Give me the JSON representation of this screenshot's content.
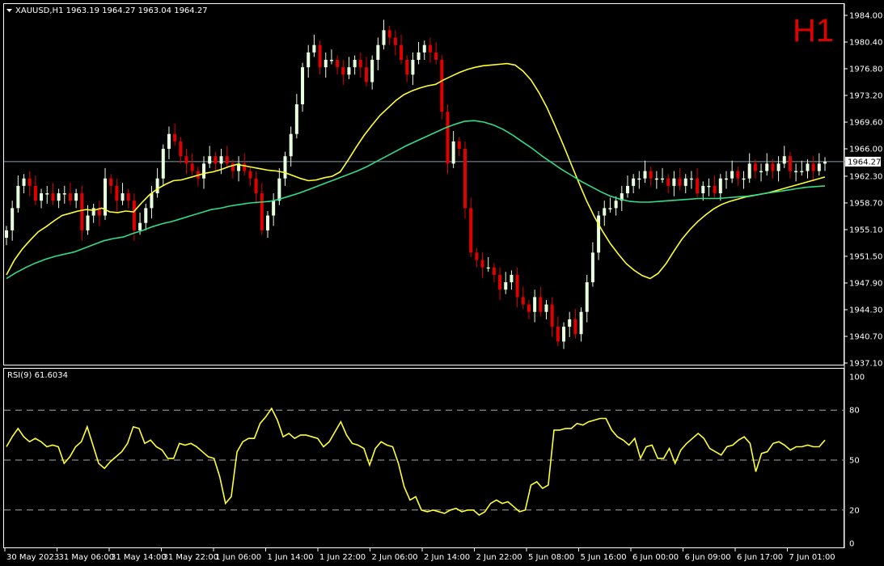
{
  "header": {
    "symbol_line": "XAUUSD,H1  1963.19 1964.27 1963.04 1964.27",
    "timeframe": "H1"
  },
  "indicator": {
    "label": "RSI(9) 61.6034",
    "scale": [
      "100",
      "80",
      "50",
      "20",
      "0"
    ]
  },
  "colors": {
    "background": "#000000",
    "bull_candle": "#e8ffe0",
    "bear_candle": "#e00000",
    "ma_fast": "#ffff33",
    "ma_slow": "#33dd88",
    "rsi_line": "#ffff33",
    "frame": "#ffffff",
    "price_line": "#8899aa"
  },
  "chart_data": [
    {
      "type": "candlestick",
      "symbol": "XAUUSD",
      "timeframe": "H1",
      "current_price": 1964.27,
      "price_label": "1964.27",
      "ylim": [
        1937.1,
        1984.0
      ],
      "y_ticks": [
        "1984.00",
        "1980.40",
        "1976.80",
        "1973.20",
        "1969.60",
        "1966.00",
        "1962.30",
        "1958.70",
        "1955.10",
        "1951.50",
        "1947.90",
        "1944.30",
        "1940.70",
        "1937.10"
      ],
      "x_ticks": [
        "30 May 2023",
        "31 May 06:00",
        "31 May 14:00",
        "31 May 22:00",
        "1 Jun 06:00",
        "1 Jun 14:00",
        "1 Jun 22:00",
        "2 Jun 06:00",
        "2 Jun 14:00",
        "2 Jun 22:00",
        "5 Jun 08:00",
        "5 Jun 16:00",
        "6 Jun 00:00",
        "6 Jun 09:00",
        "6 Jun 17:00",
        "7 Jun 01:00"
      ],
      "close": [
        1955,
        1958,
        1961,
        1962,
        1961,
        1959,
        1960,
        1960,
        1959,
        1960,
        1960,
        1959,
        1960,
        1955,
        1957,
        1958,
        1957,
        1962,
        1961,
        1959,
        1960,
        1959,
        1955,
        1956,
        1958,
        1960,
        1962,
        1966,
        1968,
        1967,
        1965,
        1964,
        1963,
        1962,
        1964,
        1965,
        1964,
        1965,
        1964,
        1963,
        1964,
        1963,
        1962,
        1960,
        1955,
        1957,
        1959,
        1962,
        1965,
        1968,
        1972,
        1977,
        1979,
        1980,
        1977,
        1978,
        1978,
        1977,
        1976,
        1977,
        1978,
        1977,
        1975,
        1978,
        1980,
        1982,
        1981,
        1980,
        1978,
        1976,
        1978,
        1979,
        1980,
        1979,
        1978,
        1971,
        1964,
        1967,
        1966,
        1958,
        1952,
        1951,
        1950,
        1950,
        1949,
        1947,
        1948,
        1949,
        1946,
        1945,
        1944,
        1946,
        1944,
        1945,
        1942,
        1940,
        1942,
        1943,
        1941,
        1944,
        1948,
        1952,
        1957,
        1958,
        1958,
        1959,
        1960,
        1961,
        1962,
        1962,
        1963,
        1962,
        1962,
        1962,
        1961,
        1962,
        1961,
        1962,
        1962,
        1960,
        1961,
        1961,
        1960,
        1962,
        1962,
        1963,
        1962,
        1962,
        1964,
        1963,
        1963,
        1964,
        1963,
        1964,
        1965,
        1963,
        1963,
        1963,
        1964,
        1963,
        1964,
        1964.27
      ],
      "series": [
        {
          "name": "",
          "description_color": "ma_fast",
          "values": [
            1949,
            1951,
            1952.5,
            1953.7,
            1954.8,
            1955.5,
            1956.3,
            1957,
            1957.3,
            1957.6,
            1957.8,
            1957.7,
            1958,
            1957.5,
            1957.4,
            1957.6,
            1957.5,
            1958.7,
            1959.8,
            1960.6,
            1961.2,
            1961.7,
            1961.8,
            1962.1,
            1962.4,
            1962.7,
            1962.9,
            1963.2,
            1963.6,
            1963.9,
            1963.7,
            1963.5,
            1963.3,
            1963.1,
            1963.0,
            1962.8,
            1962.4,
            1962.0,
            1961.7,
            1961.8,
            1962.1,
            1962.3,
            1962.9,
            1964.5,
            1966.2,
            1967.8,
            1969.2,
            1970.5,
            1971.5,
            1972.5,
            1973.3,
            1973.8,
            1974.2,
            1974.5,
            1974.7,
            1975.3,
            1975.8,
            1976.3,
            1976.7,
            1977.0,
            1977.2,
            1977.3,
            1977.4,
            1977.5,
            1977.3,
            1976.5,
            1975.3,
            1973.6,
            1971.6,
            1969.2,
            1966.7,
            1964.1,
            1961.5,
            1959.0,
            1956.8,
            1954.9,
            1953.2,
            1951.8,
            1950.5,
            1949.6,
            1948.9,
            1948.5,
            1949.2,
            1950.5,
            1952.2,
            1953.8,
            1955.1,
            1956.2,
            1957.1,
            1957.9,
            1958.5,
            1958.9,
            1959.2,
            1959.5,
            1959.7,
            1959.9,
            1960.1,
            1960.4,
            1960.7,
            1961.0,
            1961.3,
            1961.6,
            1961.9,
            1962.2
          ]
        },
        {
          "name": "",
          "description_color": "ma_slow",
          "values": [
            1948.5,
            1949.3,
            1950.0,
            1950.6,
            1951.1,
            1951.5,
            1951.8,
            1952.1,
            1952.6,
            1953.1,
            1953.6,
            1953.9,
            1954.1,
            1954.6,
            1955.0,
            1955.5,
            1955.9,
            1956.2,
            1956.6,
            1957.0,
            1957.4,
            1957.8,
            1958.0,
            1958.3,
            1958.5,
            1958.7,
            1958.8,
            1958.9,
            1959.2,
            1959.6,
            1960.0,
            1960.5,
            1961.0,
            1961.5,
            1962.0,
            1962.5,
            1963.0,
            1963.6,
            1964.3,
            1965.0,
            1965.7,
            1966.4,
            1967.0,
            1967.6,
            1968.2,
            1968.8,
            1969.3,
            1969.7,
            1969.8,
            1969.6,
            1969.2,
            1968.6,
            1967.8,
            1966.9,
            1966.0,
            1965.0,
            1964.1,
            1963.2,
            1962.4,
            1961.6,
            1960.9,
            1960.2,
            1959.6,
            1959.2,
            1958.9,
            1958.8,
            1958.8,
            1958.9,
            1959.0,
            1959.1,
            1959.2,
            1959.3,
            1959.3,
            1959.3,
            1959.4,
            1959.5,
            1959.6,
            1959.8,
            1960.0,
            1960.2,
            1960.4,
            1960.6,
            1960.8,
            1960.9,
            1961.0
          ]
        }
      ]
    },
    {
      "type": "line",
      "title": "RSI(9) 61.6034",
      "ylim": [
        0,
        100
      ],
      "levels": [
        80,
        50,
        20
      ],
      "x_ticks": [
        "30 May 2023",
        "31 May 06:00",
        "31 May 14:00",
        "31 May 22:00",
        "1 Jun 06:00",
        "1 Jun 14:00",
        "1 Jun 22:00",
        "2 Jun 06:00",
        "2 Jun 14:00",
        "2 Jun 22:00",
        "5 Jun 08:00",
        "5 Jun 16:00",
        "6 Jun 00:00",
        "6 Jun 09:00",
        "6 Jun 17:00",
        "7 Jun 01:00"
      ],
      "series": [
        {
          "name": "",
          "values": [
            58,
            64,
            69,
            64,
            61,
            63,
            61,
            58,
            59,
            58,
            48,
            52,
            58,
            61,
            70,
            59,
            48,
            45,
            49,
            52,
            55,
            60,
            70,
            69,
            60,
            62,
            58,
            56,
            51,
            51,
            60,
            59,
            60,
            58,
            55,
            52,
            51,
            40,
            24,
            28,
            55,
            61,
            63,
            63,
            72,
            76,
            81,
            74,
            64,
            66,
            63,
            65,
            65,
            64,
            63,
            58,
            61,
            67,
            73,
            65,
            60,
            59,
            57,
            47,
            57,
            61,
            59,
            58,
            48,
            34,
            26,
            28,
            20,
            19,
            20,
            19,
            18,
            20,
            21,
            19,
            20,
            20,
            17,
            19,
            24,
            26,
            24,
            25,
            22,
            19,
            20,
            35,
            37,
            33,
            35,
            68,
            68,
            69,
            69,
            72,
            71,
            73,
            74,
            75,
            75,
            68,
            64,
            62,
            59,
            63,
            51,
            58,
            59,
            51,
            51,
            57,
            48,
            56,
            60,
            63,
            66,
            63,
            57,
            55,
            53,
            58,
            59,
            62,
            64,
            60,
            43,
            54,
            55,
            60,
            61,
            59,
            56,
            58,
            58,
            59,
            58,
            58,
            62
          ]
        }
      ]
    }
  ]
}
